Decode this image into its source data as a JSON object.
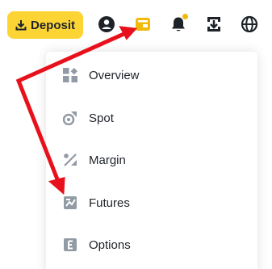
{
  "header": {
    "deposit_label": "Deposit",
    "icons": [
      "download-icon",
      "user-icon",
      "wallet-icon",
      "bell-icon",
      "transfer-icon",
      "globe-icon"
    ],
    "notification_dot_color": "#f0b90b"
  },
  "menu": {
    "items": [
      {
        "label": "Overview",
        "icon": "overview-icon"
      },
      {
        "label": "Spot",
        "icon": "spot-icon"
      },
      {
        "label": "Margin",
        "icon": "margin-icon"
      },
      {
        "label": "Futures",
        "icon": "futures-icon"
      },
      {
        "label": "Options",
        "icon": "options-icon"
      }
    ]
  },
  "colors": {
    "accent": "#fcd535",
    "text": "#1e2329",
    "icon_gray": "#929aa5",
    "annotation": "#e8101a"
  }
}
